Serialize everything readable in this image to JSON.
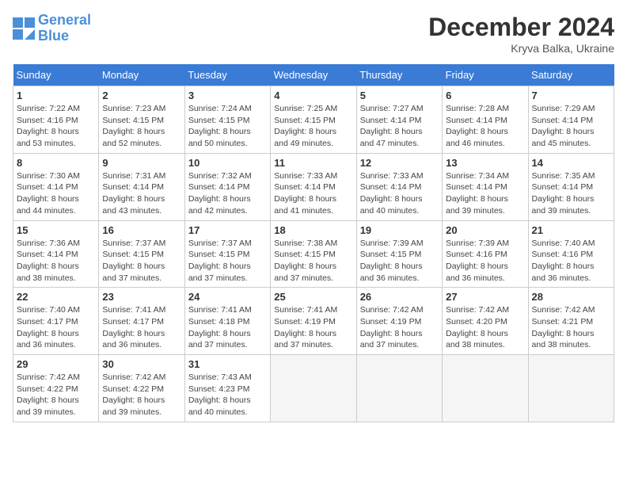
{
  "header": {
    "logo_line1": "General",
    "logo_line2": "Blue",
    "month": "December 2024",
    "location": "Kryva Balka, Ukraine"
  },
  "weekdays": [
    "Sunday",
    "Monday",
    "Tuesday",
    "Wednesday",
    "Thursday",
    "Friday",
    "Saturday"
  ],
  "days": [
    {
      "num": "",
      "info": ""
    },
    {
      "num": "",
      "info": ""
    },
    {
      "num": "",
      "info": ""
    },
    {
      "num": "",
      "info": ""
    },
    {
      "num": "",
      "info": ""
    },
    {
      "num": "",
      "info": ""
    },
    {
      "num": "",
      "info": ""
    },
    {
      "num": "1",
      "info": "Sunrise: 7:22 AM\nSunset: 4:16 PM\nDaylight: 8 hours\nand 53 minutes."
    },
    {
      "num": "2",
      "info": "Sunrise: 7:23 AM\nSunset: 4:15 PM\nDaylight: 8 hours\nand 52 minutes."
    },
    {
      "num": "3",
      "info": "Sunrise: 7:24 AM\nSunset: 4:15 PM\nDaylight: 8 hours\nand 50 minutes."
    },
    {
      "num": "4",
      "info": "Sunrise: 7:25 AM\nSunset: 4:15 PM\nDaylight: 8 hours\nand 49 minutes."
    },
    {
      "num": "5",
      "info": "Sunrise: 7:27 AM\nSunset: 4:14 PM\nDaylight: 8 hours\nand 47 minutes."
    },
    {
      "num": "6",
      "info": "Sunrise: 7:28 AM\nSunset: 4:14 PM\nDaylight: 8 hours\nand 46 minutes."
    },
    {
      "num": "7",
      "info": "Sunrise: 7:29 AM\nSunset: 4:14 PM\nDaylight: 8 hours\nand 45 minutes."
    },
    {
      "num": "8",
      "info": "Sunrise: 7:30 AM\nSunset: 4:14 PM\nDaylight: 8 hours\nand 44 minutes."
    },
    {
      "num": "9",
      "info": "Sunrise: 7:31 AM\nSunset: 4:14 PM\nDaylight: 8 hours\nand 43 minutes."
    },
    {
      "num": "10",
      "info": "Sunrise: 7:32 AM\nSunset: 4:14 PM\nDaylight: 8 hours\nand 42 minutes."
    },
    {
      "num": "11",
      "info": "Sunrise: 7:33 AM\nSunset: 4:14 PM\nDaylight: 8 hours\nand 41 minutes."
    },
    {
      "num": "12",
      "info": "Sunrise: 7:33 AM\nSunset: 4:14 PM\nDaylight: 8 hours\nand 40 minutes."
    },
    {
      "num": "13",
      "info": "Sunrise: 7:34 AM\nSunset: 4:14 PM\nDaylight: 8 hours\nand 39 minutes."
    },
    {
      "num": "14",
      "info": "Sunrise: 7:35 AM\nSunset: 4:14 PM\nDaylight: 8 hours\nand 39 minutes."
    },
    {
      "num": "15",
      "info": "Sunrise: 7:36 AM\nSunset: 4:14 PM\nDaylight: 8 hours\nand 38 minutes."
    },
    {
      "num": "16",
      "info": "Sunrise: 7:37 AM\nSunset: 4:15 PM\nDaylight: 8 hours\nand 37 minutes."
    },
    {
      "num": "17",
      "info": "Sunrise: 7:37 AM\nSunset: 4:15 PM\nDaylight: 8 hours\nand 37 minutes."
    },
    {
      "num": "18",
      "info": "Sunrise: 7:38 AM\nSunset: 4:15 PM\nDaylight: 8 hours\nand 37 minutes."
    },
    {
      "num": "19",
      "info": "Sunrise: 7:39 AM\nSunset: 4:15 PM\nDaylight: 8 hours\nand 36 minutes."
    },
    {
      "num": "20",
      "info": "Sunrise: 7:39 AM\nSunset: 4:16 PM\nDaylight: 8 hours\nand 36 minutes."
    },
    {
      "num": "21",
      "info": "Sunrise: 7:40 AM\nSunset: 4:16 PM\nDaylight: 8 hours\nand 36 minutes."
    },
    {
      "num": "22",
      "info": "Sunrise: 7:40 AM\nSunset: 4:17 PM\nDaylight: 8 hours\nand 36 minutes."
    },
    {
      "num": "23",
      "info": "Sunrise: 7:41 AM\nSunset: 4:17 PM\nDaylight: 8 hours\nand 36 minutes."
    },
    {
      "num": "24",
      "info": "Sunrise: 7:41 AM\nSunset: 4:18 PM\nDaylight: 8 hours\nand 37 minutes."
    },
    {
      "num": "25",
      "info": "Sunrise: 7:41 AM\nSunset: 4:19 PM\nDaylight: 8 hours\nand 37 minutes."
    },
    {
      "num": "26",
      "info": "Sunrise: 7:42 AM\nSunset: 4:19 PM\nDaylight: 8 hours\nand 37 minutes."
    },
    {
      "num": "27",
      "info": "Sunrise: 7:42 AM\nSunset: 4:20 PM\nDaylight: 8 hours\nand 38 minutes."
    },
    {
      "num": "28",
      "info": "Sunrise: 7:42 AM\nSunset: 4:21 PM\nDaylight: 8 hours\nand 38 minutes."
    },
    {
      "num": "29",
      "info": "Sunrise: 7:42 AM\nSunset: 4:22 PM\nDaylight: 8 hours\nand 39 minutes."
    },
    {
      "num": "30",
      "info": "Sunrise: 7:42 AM\nSunset: 4:22 PM\nDaylight: 8 hours\nand 39 minutes."
    },
    {
      "num": "31",
      "info": "Sunrise: 7:43 AM\nSunset: 4:23 PM\nDaylight: 8 hours\nand 40 minutes."
    },
    {
      "num": "",
      "info": ""
    },
    {
      "num": "",
      "info": ""
    },
    {
      "num": "",
      "info": ""
    },
    {
      "num": "",
      "info": ""
    },
    {
      "num": "",
      "info": ""
    }
  ]
}
